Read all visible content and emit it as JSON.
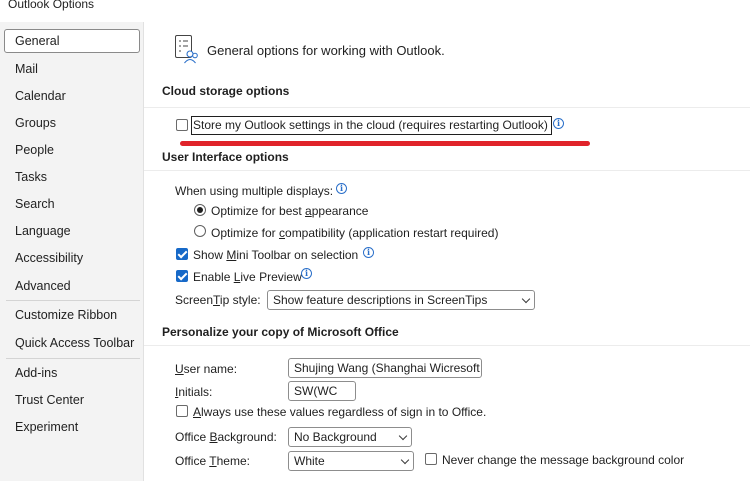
{
  "window": {
    "title": "Outlook Options"
  },
  "sidebar": {
    "items": [
      {
        "label": "General",
        "selected": true
      },
      {
        "label": "Mail"
      },
      {
        "label": "Calendar"
      },
      {
        "label": "Groups"
      },
      {
        "label": "People"
      },
      {
        "label": "Tasks"
      },
      {
        "label": "Search"
      },
      {
        "label": "Language"
      },
      {
        "label": "Accessibility"
      },
      {
        "label": "Advanced"
      },
      {
        "label": "Customize Ribbon"
      },
      {
        "label": "Quick Access Toolbar"
      },
      {
        "label": "Add-ins"
      },
      {
        "label": "Trust Center"
      },
      {
        "label": "Experiment"
      }
    ]
  },
  "main": {
    "header": {
      "text": "General options for working with Outlook.",
      "icon": "options-list-icon"
    },
    "cloud": {
      "title": "Cloud storage options",
      "store_settings": {
        "label": "Store my Outlook settings in the cloud (requires restarting Outlook)",
        "checked": false
      }
    },
    "ui": {
      "title": "User Interface options",
      "multiple_displays_label": "When using multiple displays:",
      "opt_best": {
        "pre": "Optimize for best ",
        "u": "a",
        "post": "ppearance",
        "selected": true
      },
      "opt_compat": {
        "pre": "Optimize for ",
        "u": "c",
        "post": "ompatibility (application restart required)",
        "selected": false
      },
      "mini_toolbar": {
        "pre": "Show ",
        "u": "M",
        "post": "ini Toolbar on selection",
        "checked": true
      },
      "live_preview": {
        "pre": "Enable ",
        "u": "L",
        "post": "ive Preview",
        "checked": true
      },
      "screentip": {
        "label_pre": "Screen",
        "label_u": "T",
        "label_post": "ip style:",
        "value": "Show feature descriptions in ScreenTips"
      }
    },
    "personalize": {
      "title": "Personalize your copy of Microsoft Office",
      "user_name": {
        "label_u": "U",
        "label_post": "ser name:",
        "value": "Shujing Wang (Shanghai Wicresoft"
      },
      "initials": {
        "label_u": "I",
        "label_post": "nitials:",
        "value": "SW(WC"
      },
      "always_use": {
        "pre": "",
        "u": "A",
        "post": "lways use these values regardless of sign in to Office.",
        "checked": false
      },
      "office_background": {
        "label_pre": "Office ",
        "label_u": "B",
        "label_post": "ackground:",
        "value": "No Background"
      },
      "office_theme": {
        "label_pre": "Office ",
        "label_u": "T",
        "label_post": "heme:",
        "value": "White"
      },
      "never_change": {
        "label": "Never change the message background color",
        "checked": false
      }
    }
  },
  "colors": {
    "accent": "#1769c8",
    "annotation": "#e0232a",
    "sidebar_bg": "#f3f3f3"
  }
}
